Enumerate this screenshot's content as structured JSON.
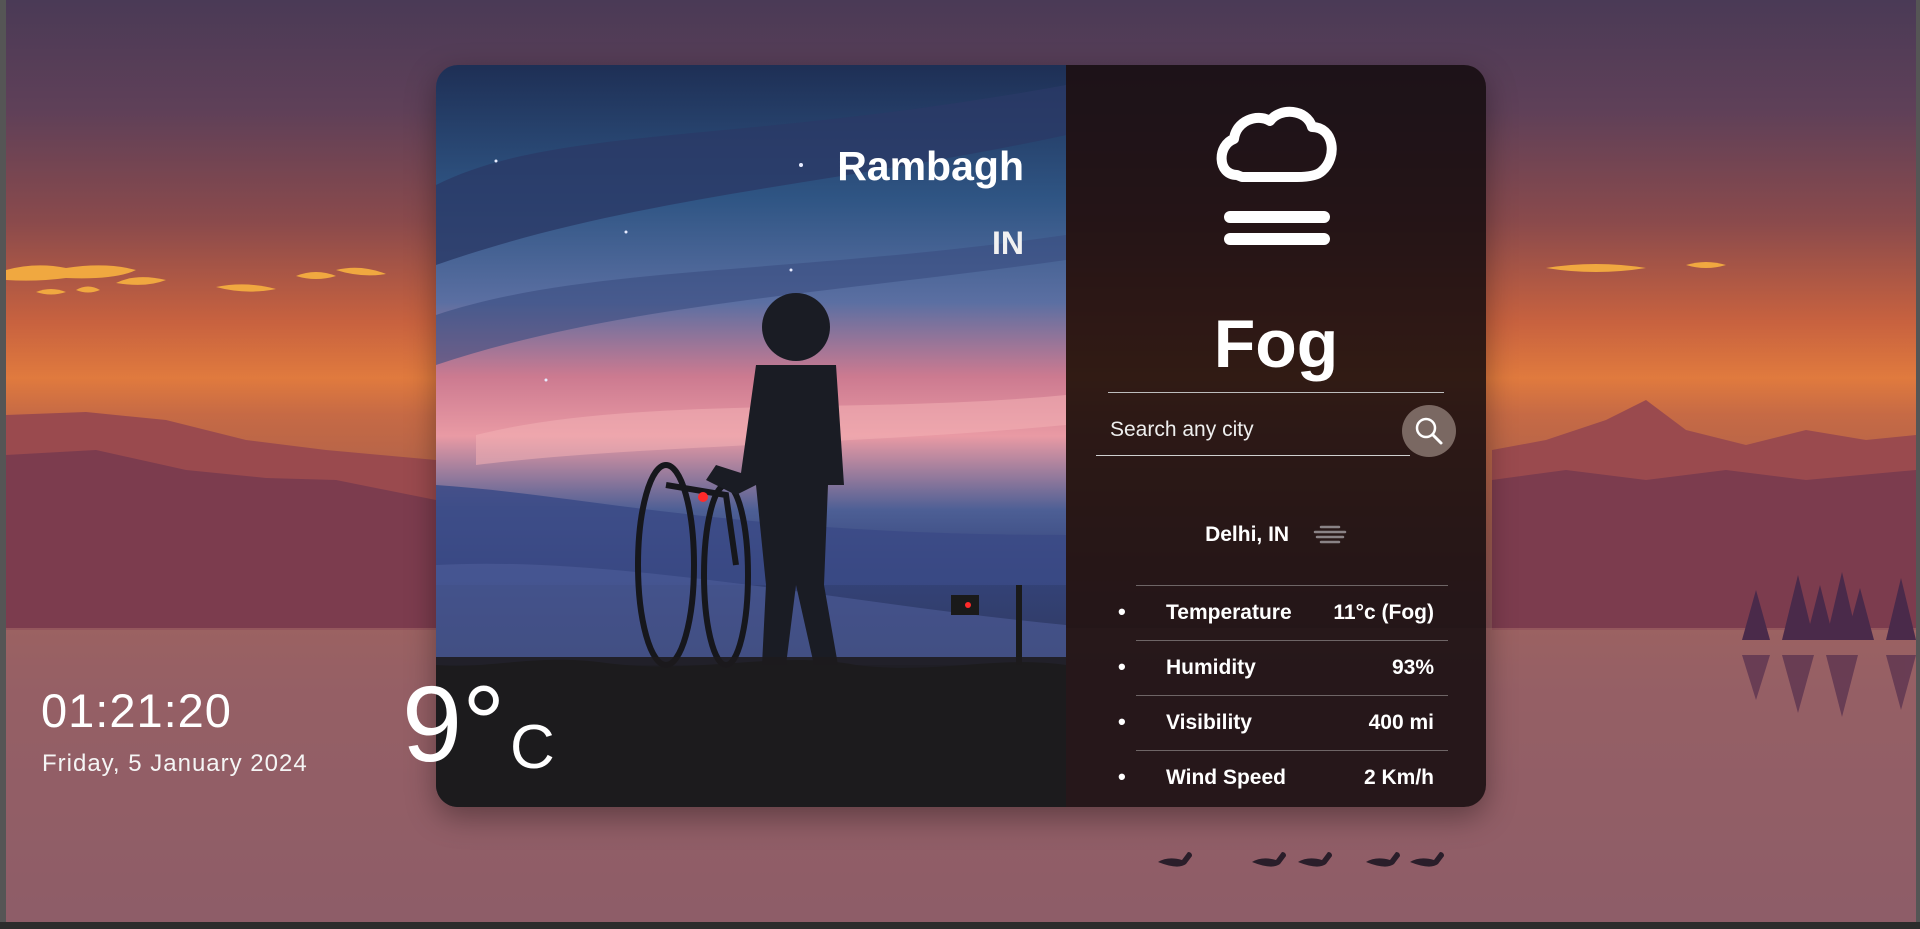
{
  "location": {
    "city": "Rambagh",
    "country": "IN"
  },
  "time": {
    "clock": "01:21:20",
    "date": "Friday, 5 January 2024"
  },
  "temperature": {
    "value": "9°",
    "unit": "C"
  },
  "weather": {
    "condition": "Fog",
    "icon": "fog-icon"
  },
  "search": {
    "placeholder": "Search any city",
    "button_icon": "search-icon"
  },
  "result": {
    "label": "Delhi, IN",
    "icon": "fog-icon"
  },
  "details": [
    {
      "label": "Temperature",
      "value": "11°c (Fog)"
    },
    {
      "label": "Humidity",
      "value": "93%"
    },
    {
      "label": "Visibility",
      "value": "400 mi"
    },
    {
      "label": "Wind Speed",
      "value": "2 Km/h"
    }
  ],
  "colors": {
    "panel_dark": "#140c0e",
    "search_button": "#7a6862",
    "text": "#ffffff"
  }
}
